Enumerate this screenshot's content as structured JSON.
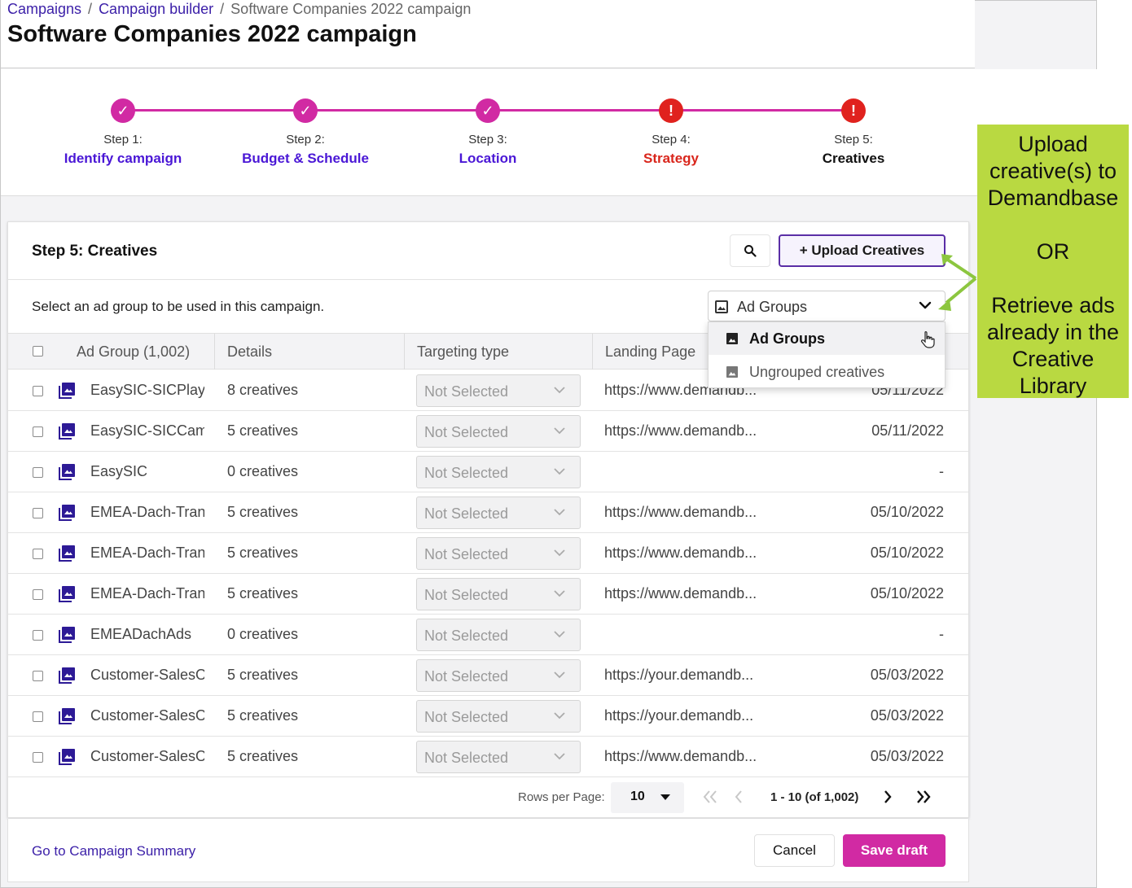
{
  "breadcrumbs": {
    "campaigns": "Campaigns",
    "builder": "Campaign builder",
    "current": "Software Companies 2022 campaign",
    "separator": "/"
  },
  "page_title": "Software Companies 2022 campaign",
  "steps": [
    {
      "num": "Step 1:",
      "name": "Identify campaign",
      "status": "done"
    },
    {
      "num": "Step 2:",
      "name": "Budget & Schedule",
      "status": "done"
    },
    {
      "num": "Step 3:",
      "name": "Location",
      "status": "done"
    },
    {
      "num": "Step 4:",
      "name": "Strategy",
      "status": "warn"
    },
    {
      "num": "Step 5:",
      "name": "Creatives",
      "status": "warn-current"
    }
  ],
  "step_icons": {
    "done": "✓",
    "warn": "!"
  },
  "card": {
    "title": "Step 5: Creatives",
    "upload_label": "+ Upload Creatives",
    "instruction": "Select an ad group to be used in this campaign."
  },
  "dropdown": {
    "value": "Ad Groups",
    "options": [
      "Ad Groups",
      "Ungrouped creatives"
    ]
  },
  "table": {
    "headers": {
      "ad_group": "Ad Group (1,002)",
      "details": "Details",
      "targeting": "Targeting type",
      "landing": "Landing Page"
    },
    "rows": [
      {
        "name": "EasySIC-SICPlaybook",
        "details": "8 creatives",
        "targeting": "Not Selected",
        "landing": "https://www.demandb...",
        "date": "05/11/2022"
      },
      {
        "name": "EasySIC-SICCampaign",
        "details": "5 creatives",
        "targeting": "Not Selected",
        "landing": "https://www.demandb...",
        "date": "05/11/2022"
      },
      {
        "name": "EasySIC",
        "details": "0 creatives",
        "targeting": "Not Selected",
        "landing": "",
        "date": "-"
      },
      {
        "name": "EMEA-Dach-Transport",
        "details": "5 creatives",
        "targeting": "Not Selected",
        "landing": "https://www.demandb...",
        "date": "05/10/2022"
      },
      {
        "name": "EMEA-Dach-Transport",
        "details": "5 creatives",
        "targeting": "Not Selected",
        "landing": "https://www.demandb...",
        "date": "05/10/2022"
      },
      {
        "name": "EMEA-Dach-Transport",
        "details": "5 creatives",
        "targeting": "Not Selected",
        "landing": "https://www.demandb...",
        "date": "05/10/2022"
      },
      {
        "name": "EMEADachAds",
        "details": "0 creatives",
        "targeting": "Not Selected",
        "landing": "",
        "date": "-"
      },
      {
        "name": "Customer-SalesOps",
        "details": "5 creatives",
        "targeting": "Not Selected",
        "landing": "https://your.demandb...",
        "date": "05/03/2022"
      },
      {
        "name": "Customer-SalesOps",
        "details": "5 creatives",
        "targeting": "Not Selected",
        "landing": "https://your.demandb...",
        "date": "05/03/2022"
      },
      {
        "name": "Customer-SalesOps",
        "details": "5 creatives",
        "targeting": "Not Selected",
        "landing": "https://www.demandb...",
        "date": "05/03/2022"
      }
    ]
  },
  "pagination": {
    "rows_label": "Rows per Page:",
    "rows_value": "10",
    "range": "1 - 10 (of 1,002)"
  },
  "footer": {
    "summary_link": "Go to Campaign Summary",
    "cancel": "Cancel",
    "save": "Save draft"
  },
  "callout": {
    "line1": "Upload",
    "line2": "creative(s) to",
    "line3": "Demandbase",
    "or": "OR",
    "line4": "Retrieve ads",
    "line5": "already in the",
    "line6": "Creative",
    "line7": "Library"
  },
  "colors": {
    "accent": "#d12aa3",
    "warning": "#e0221e",
    "link": "#3b1fa8",
    "callout": "#b9d941"
  }
}
